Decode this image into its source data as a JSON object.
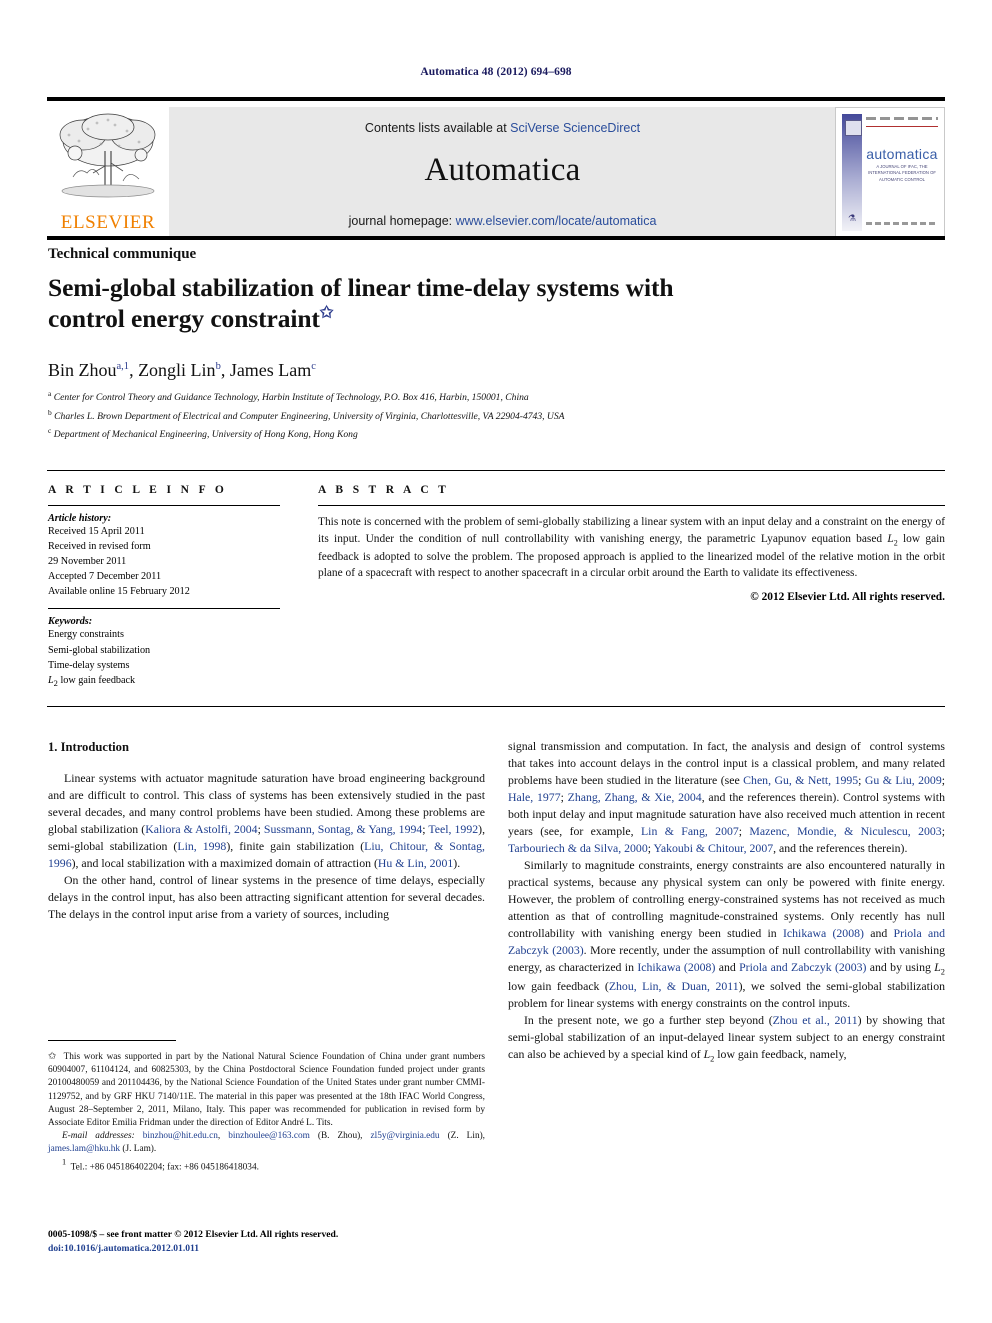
{
  "running_head": "Automatica 48 (2012) 694–698",
  "masthead": {
    "publisher_name": "ELSEVIER",
    "contents_prefix": "Contents lists available at ",
    "contents_link": "SciVerse ScienceDirect",
    "journal_title": "Automatica",
    "homepage_prefix": "journal homepage: ",
    "homepage_link": "www.elsevier.com/locate/automatica",
    "cover_title": "automatica",
    "cover_subtitle": "A JOURNAL OF IFAC, THE INTERNATIONAL FEDERATION OF AUTOMATIC CONTROL"
  },
  "article": {
    "doctype": "Technical communique",
    "title": "Semi-global stabilization of linear time-delay systems with control energy constraint",
    "title_star": "✩",
    "authors_html": "Bin Zhou<sup>a,1</sup>, Zongli Lin<sup>b</sup>, James Lam<sup>c</sup>",
    "affiliations": [
      {
        "mark": "a",
        "text": "Center for Control Theory and Guidance Technology, Harbin Institute of Technology, P.O. Box 416, Harbin, 150001, China"
      },
      {
        "mark": "b",
        "text": "Charles L. Brown Department of Electrical and Computer Engineering, University of Virginia, Charlottesville, VA 22904-4743, USA"
      },
      {
        "mark": "c",
        "text": "Department of Mechanical Engineering, University of Hong Kong, Hong Kong"
      }
    ]
  },
  "info": {
    "heading": "A R T I C L E   I N F O",
    "history_label": "Article history:",
    "history": [
      "Received 15 April 2011",
      "Received in revised form",
      "29 November 2011",
      "Accepted 7 December 2011",
      "Available online 15 February 2012"
    ],
    "keywords_label": "Keywords:",
    "keywords": [
      "Energy constraints",
      "Semi-global stabilization",
      "Time-delay systems",
      "L2 low gain feedback"
    ],
    "keyword_last_html": "<i>L</i><sub>2</sub> low gain feedback"
  },
  "abstract": {
    "heading": "A B S T R A C T",
    "body_html": "This note is concerned with the problem of semi-globally stabilizing a linear system with an input delay and a constraint on the energy of its input. Under the condition of null controllability with vanishing energy, the parametric Lyapunov equation based <i>L</i><sub>2</sub> low gain feedback is adopted to solve the problem. The proposed approach is applied to the linearized model of the relative motion in the orbit plane of a spacecraft with respect to another spacecraft in a circular orbit around the Earth to validate its effectiveness.",
    "copyright": "© 2012 Elsevier Ltd. All rights reserved."
  },
  "body": {
    "section_heading": "1. Introduction",
    "left_paragraphs_html": [
      "Linear systems with actuator magnitude saturation have broad engineering background and are difficult to control. This class of systems has been extensively studied in the past several decades, and many control problems have been studied. Among these problems are global stabilization (<span class=\"cite\">Kaliora &amp; Astolfi, 2004</span>; <span class=\"cite\">Sussmann, Sontag, &amp; Yang, 1994</span>; <span class=\"cite\">Teel, 1992</span>), semi-global stabilization (<span class=\"cite\">Lin, 1998</span>), finite gain stabilization (<span class=\"cite\">Liu, Chitour, &amp; Sontag, 1996</span>), and local stabilization with a maximized domain of attraction (<span class=\"cite\">Hu &amp; Lin, 2001</span>).",
      "On the other hand, control of linear systems in the presence of time delays, especially delays in the control input, has also been attracting significant attention for several decades. The delays in the control input arise from a variety of sources, including"
    ],
    "right_paragraphs_html": [
      "signal transmission and computation. In fact, the analysis and design of&nbsp; control systems that takes into account delays in the control input is a classical problem, and many related problems have been studied in the literature (see <span class=\"cite\">Chen, Gu, &amp; Nett, 1995</span>; <span class=\"cite\">Gu &amp; Liu, 2009</span>; <span class=\"cite\">Hale, 1977</span>; <span class=\"cite\">Zhang, Zhang, &amp; Xie, 2004</span>, and the references therein). Control systems with both input delay and input magnitude saturation have also received much attention in recent years (see, for example, <span class=\"cite\">Lin &amp; Fang, 2007</span>; <span class=\"cite\">Mazenc, Mondie, &amp; Niculescu, 2003</span>; <span class=\"cite\">Tarbouriech &amp; da Silva, 2000</span>; <span class=\"cite\">Yakoubi &amp; Chitour, 2007</span>, and the references therein).",
      "Similarly to magnitude constraints, energy constraints are also encountered naturally in practical systems, because any physical system can only be powered with finite energy. However, the problem of controlling energy-constrained systems has not received as much attention as that of controlling magnitude-constrained systems. Only recently has null controllability with vanishing energy been studied in <span class=\"cite\">Ichikawa (2008)</span> and <span class=\"cite\">Priola and Zabczyk (2003)</span>. More recently, under the assumption of null controllability with vanishing energy, as characterized in <span class=\"cite\">Ichikawa (2008)</span> and <span class=\"cite\">Priola and Zabczyk (2003)</span> and by using <i>L</i><sub>2</sub> low gain feedback (<span class=\"cite\">Zhou, Lin, &amp; Duan, 2011</span>), we solved the semi-global stabilization problem for linear systems with energy constraints on the control inputs.",
      "In the present note, we go a further step beyond (<span class=\"cite\">Zhou et al., 2011</span>) by showing that semi-global stabilization of an input-delayed linear system subject to an energy constraint can also be achieved by a special kind of <i>L</i><sub>2</sub> low gain feedback, namely,"
    ]
  },
  "footnotes": {
    "funding_html": "<span class=\"marker\">✩</span>&nbsp; This work was supported in part by the National Natural Science Foundation of China under grant numbers 60904007, 61104124, and 60825303, by the China Postdoctoral Science Foundation funded project under grants 20100480059 and 201104436, by the National Science Foundation of the United States under grant number CMMI-1129752, and by GRF HKU 7140/11E. The material in this paper was presented at the 18th IFAC World Congress, August 28–September 2, 2011, Milano, Italy. This paper was recommended for publication in revised form by Associate Editor Emilia Fridman under the direction of Editor André L. Tits.",
    "email_html": "<span class=\"email-label\">E-mail addresses:</span> <span class=\"mail\">binzhou@hit.edu.cn</span>, <span class=\"mail\">binzhoulee@163.com</span> (B. Zhou), <span class=\"mail\">zl5y@virginia.edu</span> (Z. Lin), <span class=\"mail\">james.lam@hku.hk</span> (J. Lam).",
    "tel_html": "<span class=\"marker\"><sup>1</sup></span>&nbsp; Tel.: +86 045186402204; fax: +86 045186418034."
  },
  "imprint": {
    "issn_line": "0005-1098/$ – see front matter © 2012 Elsevier Ltd. All rights reserved.",
    "doi_line": "doi:10.1016/j.automatica.2012.01.011"
  },
  "colors": {
    "link_blue": "#2a4d9b",
    "cite_blue": "#1f3f8f",
    "header_navy": "#1a1a5e",
    "elsevier_orange": "#F08000",
    "masthead_grey": "#e8e8e8"
  }
}
